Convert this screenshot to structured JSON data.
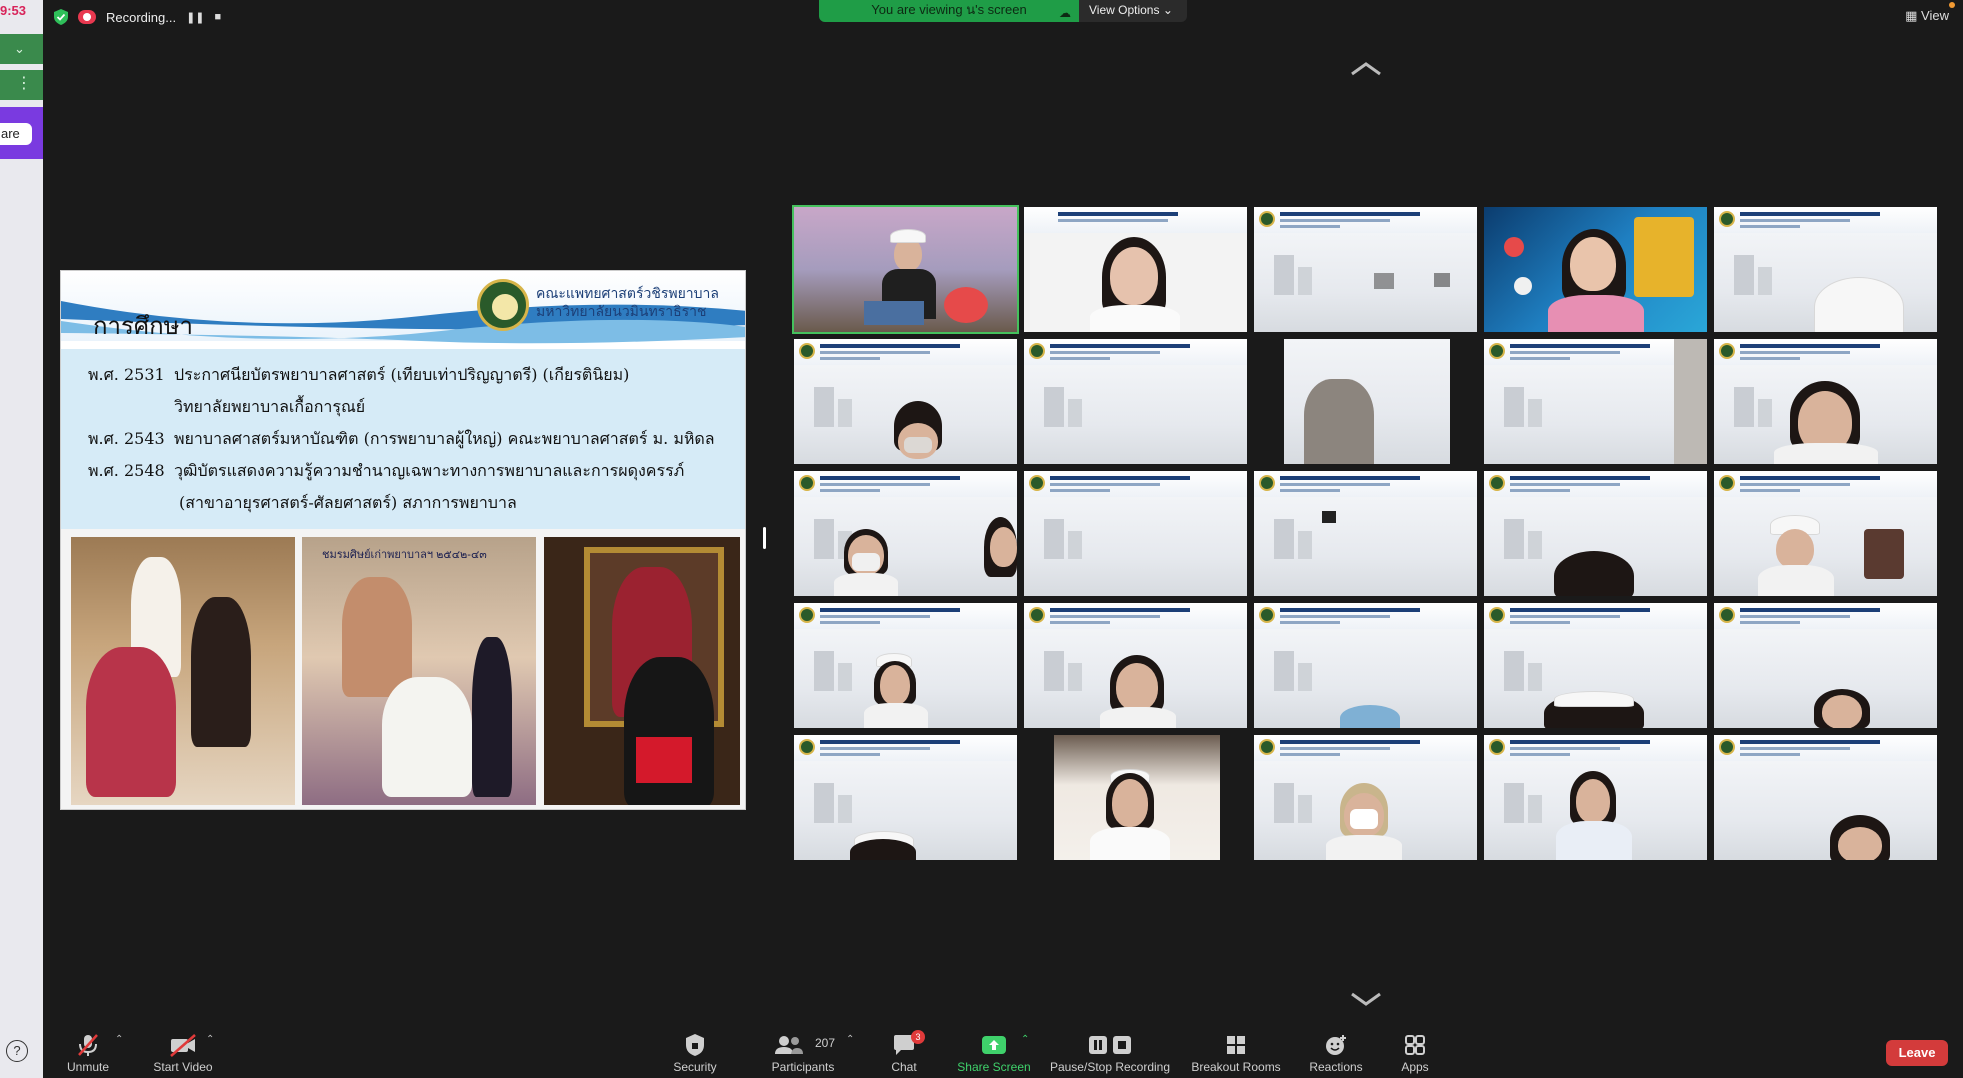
{
  "system": {
    "clock_fragment": "9:53"
  },
  "left_app": {
    "share_label": "are"
  },
  "recording": {
    "label": "Recording..."
  },
  "banner": {
    "viewing_text": "You are viewing น's screen",
    "view_options": "View Options",
    "view_button": "View"
  },
  "slide": {
    "title": "การศึกษา",
    "org_line1": "คณะแพทยศาสตร์วชิรพยาบาล",
    "org_line2": "มหาวิทยาลัยนวมินทราธิราช",
    "education": [
      {
        "year": "พ.ศ. 2531",
        "text": "ประกาศนียบัตรพยาบาลศาสตร์ (เทียบเท่าปริญญาตรี) (เกียรตินิยม)"
      },
      {
        "year": "",
        "text": "วิทยาลัยพยาบาลเกื้อการุณย์"
      },
      {
        "year": "พ.ศ. 2543",
        "text": "พยาบาลศาสตร์มหาบัณฑิต (การพยาบาลผู้ใหญ่) คณะพยาบาลศาสตร์ ม. มหิดล"
      },
      {
        "year": "พ.ศ. 2548",
        "text": "วุฒิบัตรแสดงความรู้ความชำนาญเฉพาะทางการพยาบาลและการผดุงครรภ์"
      },
      {
        "year": "",
        "text": "(สาขาอายุรศาสตร์-ศัลยศาสตร์) สภาการพยาบาล"
      }
    ],
    "photo2_caption": "ชมรมศิษย์เก่าพยาบาลฯ ๒๕๔๒-๔๓"
  },
  "toolbar": {
    "unmute": "Unmute",
    "start_video": "Start Video",
    "security": "Security",
    "participants": "Participants",
    "participants_count": "207",
    "chat": "Chat",
    "chat_badge": "3",
    "share_screen": "Share Screen",
    "pause_stop": "Pause/Stop Recording",
    "breakout": "Breakout Rooms",
    "reactions": "Reactions",
    "apps": "Apps",
    "leave": "Leave"
  },
  "colors": {
    "share_green": "#3fd16b",
    "active_speaker": "#45c15d",
    "leave_red": "#d33b3b",
    "recording_red": "#e8384f"
  },
  "participants_grid": {
    "rows": 5,
    "cols": 5
  }
}
